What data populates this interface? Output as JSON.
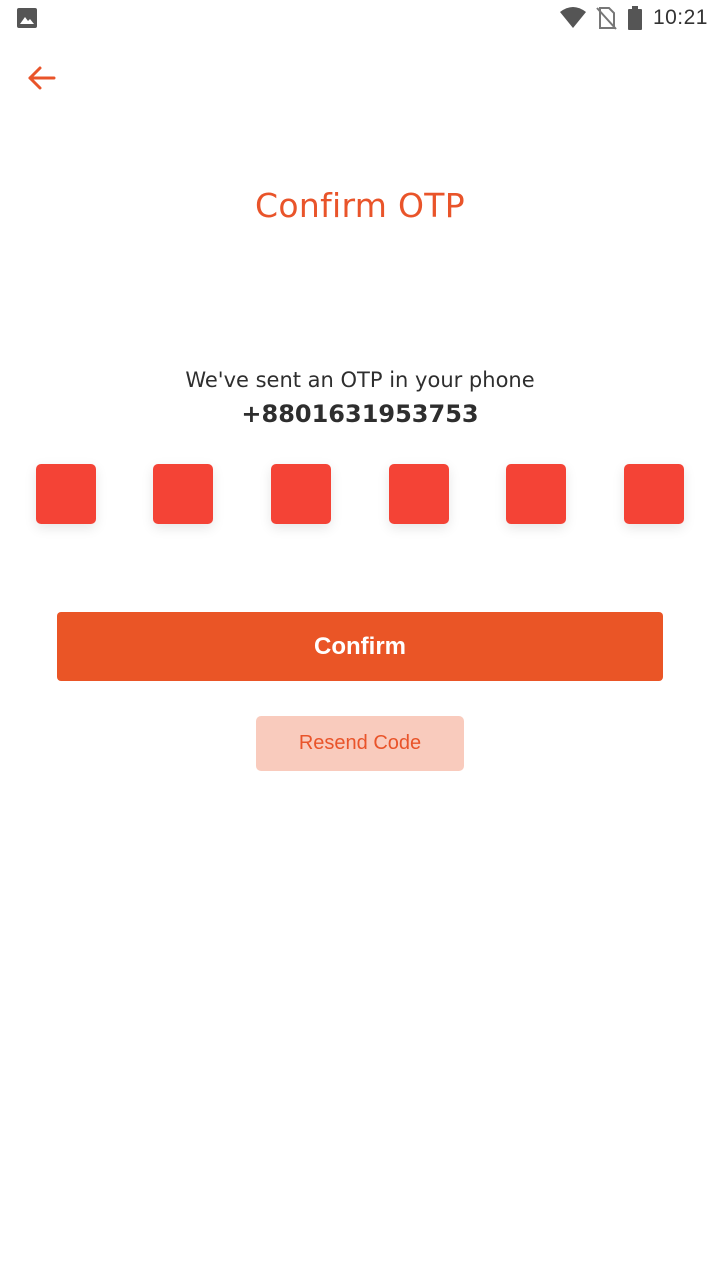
{
  "status_bar": {
    "time": "10:21",
    "icons": [
      "image-notification-icon",
      "wifi-icon",
      "no-sim-icon",
      "battery-icon"
    ]
  },
  "nav": {
    "back_icon": "arrow-left-icon"
  },
  "page": {
    "title": "Confirm OTP",
    "info_text": "We've sent an OTP in your phone",
    "phone_number": "+8801631953753"
  },
  "otp": {
    "digits": [
      "",
      "",
      "",
      "",
      "",
      ""
    ]
  },
  "actions": {
    "confirm_label": "Confirm",
    "resend_label": "Resend Code"
  },
  "colors": {
    "accent": "#E9542A",
    "otp_box": "#F44336",
    "confirm_bg": "#EA5526",
    "resend_bg": "#F9CBBD",
    "text_dark": "#2e2e2e"
  }
}
